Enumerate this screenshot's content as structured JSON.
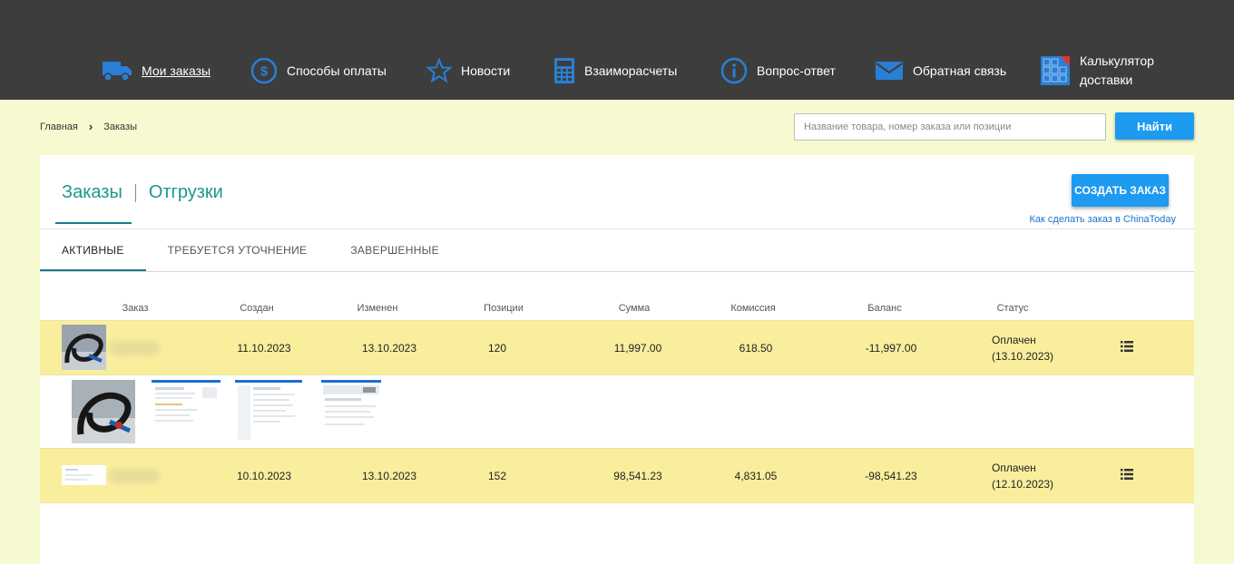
{
  "nav": [
    {
      "label": "Мои заказы",
      "icon": "truck-icon",
      "active": true
    },
    {
      "label": "Способы оплаты",
      "icon": "dollar-icon",
      "active": false
    },
    {
      "label": "Новости",
      "icon": "star-icon",
      "active": false
    },
    {
      "label": "Взаиморасчеты",
      "icon": "calculator-icon",
      "active": false
    },
    {
      "label": "Вопрос-ответ",
      "icon": "info-icon",
      "active": false
    },
    {
      "label": "Обратная связь",
      "icon": "envelope-icon",
      "active": false
    },
    {
      "label": "Калькулятор\nдоставки",
      "icon": "delivery-calculator-icon",
      "active": false
    }
  ],
  "breadcrumb": {
    "home": "Главная",
    "current": "Заказы"
  },
  "search": {
    "placeholder": "Название товара, номер заказа или позиции",
    "value": "",
    "button": "Найти"
  },
  "main_tabs": {
    "orders": "Заказы",
    "shipments": "Отгрузки"
  },
  "create_button": "СОЗДАТЬ ЗАКАЗ",
  "howto_link": "Как сделать заказ в ChinaToday",
  "sub_tabs": [
    "АКТИВНЫЕ",
    "ТРЕБУЕТСЯ УТОЧНЕНИЕ",
    "ЗАВЕРШЕННЫЕ"
  ],
  "columns": [
    "Заказ",
    "Создан",
    "Изменен",
    "Позиции",
    "Сумма",
    "Комиссия",
    "Баланс",
    "Статус"
  ],
  "orders": [
    {
      "created": "11.10.2023",
      "modified": "13.10.2023",
      "positions": "120",
      "sum": "11,997.00",
      "commission": "618.50",
      "balance": "-11,997.00",
      "status": "Оплачен",
      "status_date": "(13.10.2023)"
    },
    {
      "created": "10.10.2023",
      "modified": "13.10.2023",
      "positions": "152",
      "sum": "98,541.23",
      "commission": "4,831.05",
      "balance": "-98,541.23",
      "status": "Оплачен",
      "status_date": "(12.10.2023)"
    }
  ],
  "colors": {
    "nav_bg": "#3d3d3d",
    "accent_blue": "#1e9af0",
    "icon_blue": "#2a7fd4",
    "teal": "#1a9a8e",
    "row_highlight": "#f9ee9c",
    "page_bg": "#f7fad0"
  }
}
